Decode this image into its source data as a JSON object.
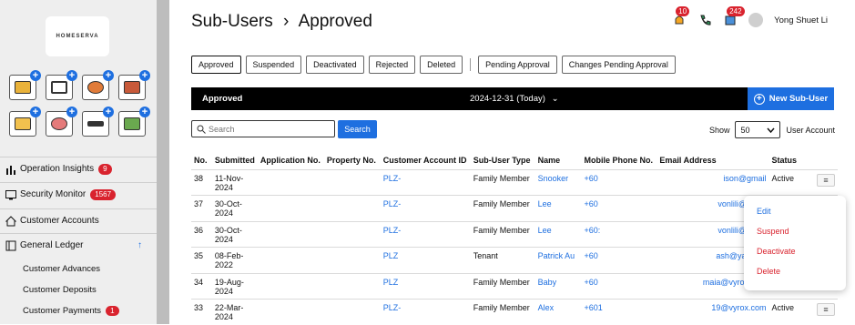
{
  "sidebar": {
    "logo_text": "HOMESERVA",
    "app_icons": [
      "property-icon",
      "calendar-icon",
      "person-cash-icon",
      "building-icon",
      "card-icon",
      "avatar-icon",
      "id-card-icon",
      "chart-board-icon"
    ],
    "nav": [
      {
        "label": "Operation Insights",
        "badge": "9",
        "icon": "bar-chart-icon"
      },
      {
        "label": "Security Monitor",
        "badge": "1567",
        "icon": "monitor-icon"
      },
      {
        "label": "Customer Accounts",
        "badge": "",
        "icon": "home-icon"
      },
      {
        "label": "General Ledger",
        "badge": "",
        "icon": "ledger-icon",
        "sort": "↑"
      }
    ],
    "subnav": [
      {
        "label": "Customer Advances",
        "badge": ""
      },
      {
        "label": "Customer Deposits",
        "badge": ""
      },
      {
        "label": "Customer Payments",
        "badge": "1"
      }
    ]
  },
  "header": {
    "title": "Sub-Users",
    "crumb_sep": "›",
    "subtitle": "Approved",
    "bell_badge": "10",
    "msg_badge": "242",
    "user_name": "Yong Shuet Li"
  },
  "tabs": [
    "Approved",
    "Suspended",
    "Deactivated",
    "Rejected",
    "Deleted",
    "Pending Approval",
    "Changes Pending Approval"
  ],
  "bar": {
    "left": "Approved",
    "date": "2024-12-31 (Today)",
    "date_caret": "⌄",
    "new_button": "New Sub-User"
  },
  "search": {
    "placeholder": "Search",
    "button": "Search"
  },
  "show": {
    "label": "Show",
    "value": "50",
    "suffix": "User Account"
  },
  "table": {
    "columns": [
      "No.",
      "Submitted",
      "Application No.",
      "Property No.",
      "Customer Account ID",
      "Sub-User Type",
      "Name",
      "Mobile Phone No.",
      "Email Address",
      "Status"
    ],
    "rows": [
      {
        "no": "38",
        "submitted": "11-Nov-\n2024",
        "app": "",
        "prop": "",
        "acct": "PLZ-",
        "type": "Family Member",
        "name": "Snooker",
        "phone": "+60",
        "email": "ison@gmail",
        "status": "Active"
      },
      {
        "no": "37",
        "submitted": "30-Oct-\n2024",
        "app": "",
        "prop": "",
        "acct": "PLZ-",
        "type": "Family Member",
        "name": "Lee",
        "phone": "+60",
        "email": "vonlili@gmail",
        "status": ""
      },
      {
        "no": "36",
        "submitted": "30-Oct-\n2024",
        "app": "",
        "prop": "",
        "acct": "PLZ-",
        "type": "Family Member",
        "name": "Lee",
        "phone": "+60:",
        "email": "vonlili@gmail",
        "status": ""
      },
      {
        "no": "35",
        "submitted": "08-Feb-\n2022",
        "app": "",
        "prop": "",
        "acct": "PLZ",
        "type": "Tenant",
        "name": "Patrick Au",
        "phone": "+60",
        "email": "ash@yahoo.c",
        "status": ""
      },
      {
        "no": "34",
        "submitted": "19-Aug-\n2024",
        "app": "",
        "prop": "",
        "acct": "PLZ",
        "type": "Family Member",
        "name": "Baby",
        "phone": "+60",
        "email": "maia@vyrox.com",
        "status": ""
      },
      {
        "no": "33",
        "submitted": "22-Mar-\n2024",
        "app": "",
        "prop": "",
        "acct": "PLZ-",
        "type": "Family Member",
        "name": "Alex",
        "phone": "+601",
        "email": "19@vyrox.com",
        "status": "Active"
      }
    ]
  },
  "menu": {
    "edit": "Edit",
    "suspend": "Suspend",
    "deactivate": "Deactivate",
    "delete": "Delete"
  },
  "colors": {
    "accent": "#1e6fe0",
    "danger": "#d9232e",
    "bar": "#000000"
  }
}
